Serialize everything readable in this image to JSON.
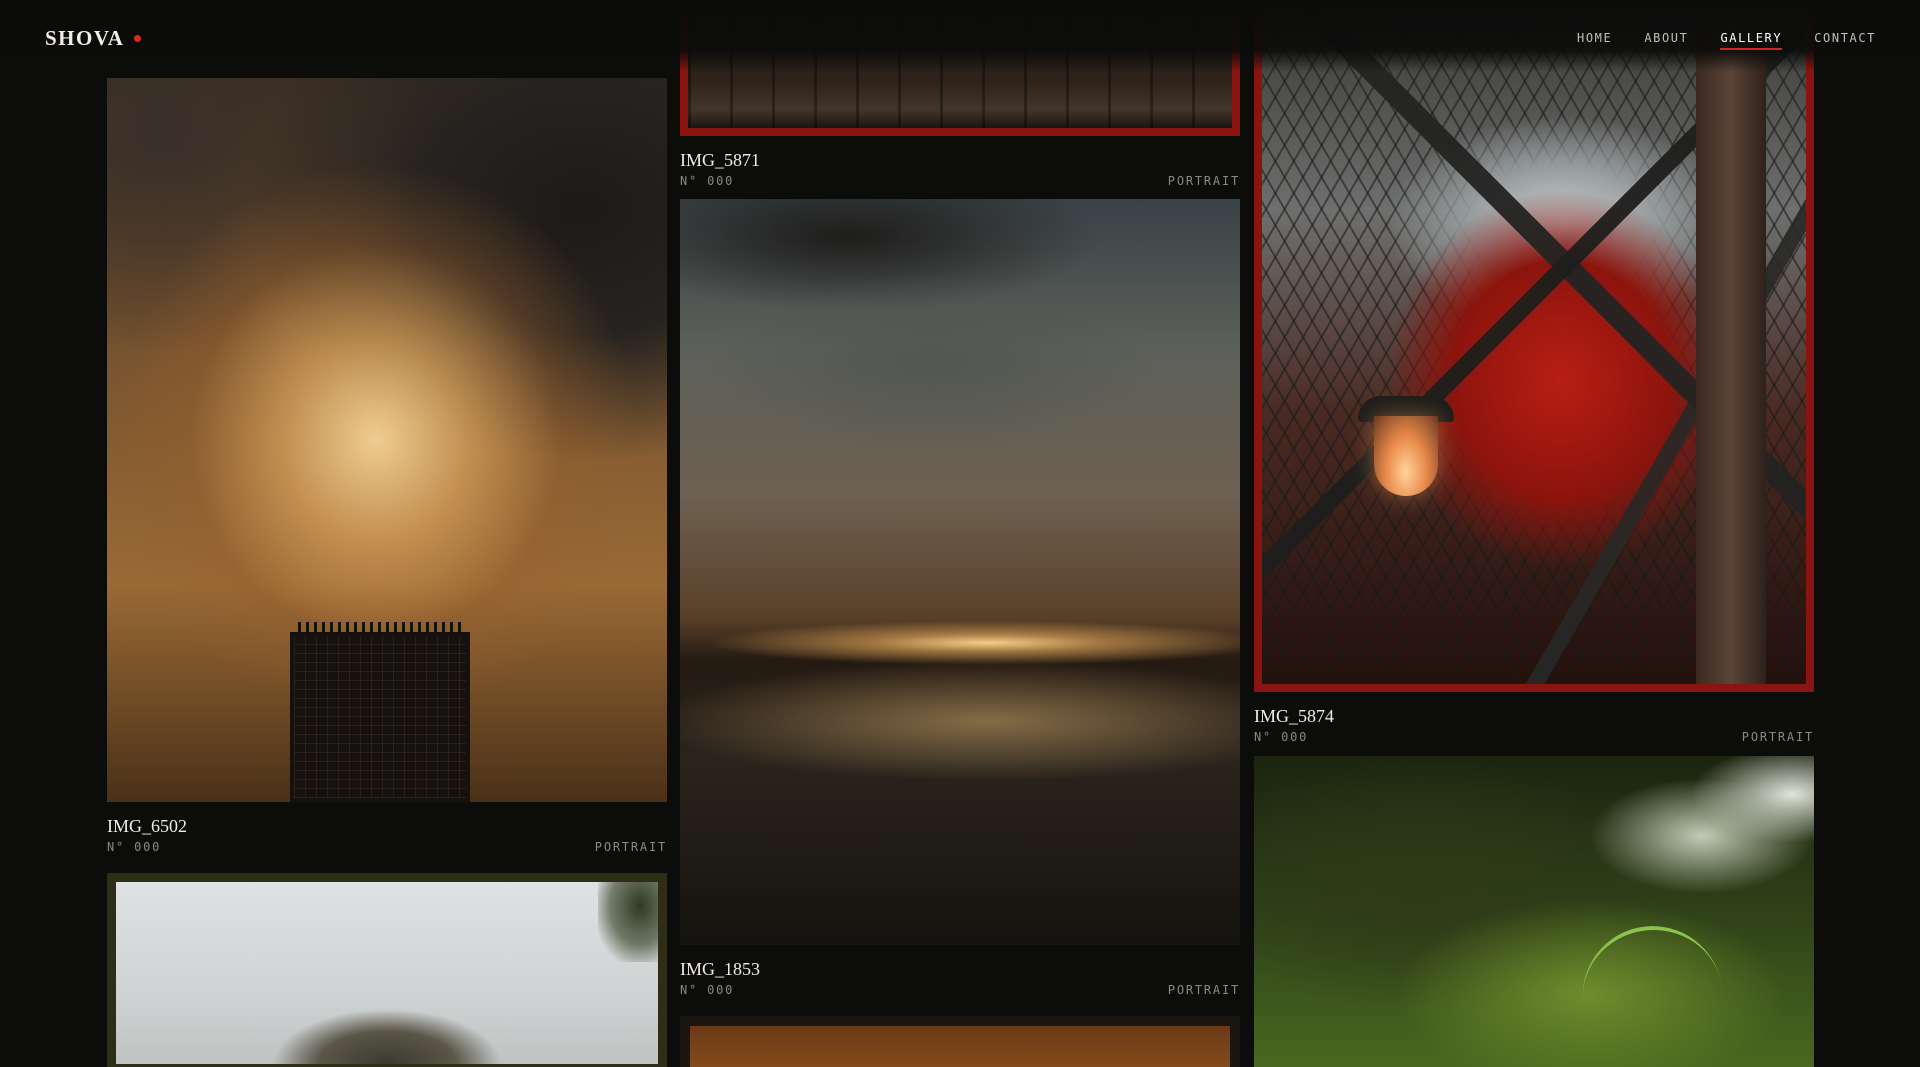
{
  "brand": {
    "name": "SHOVA"
  },
  "nav": {
    "items": [
      "HOME",
      "ABOUT",
      "GALLERY",
      "CONTACT"
    ],
    "active": "GALLERY"
  },
  "colors": {
    "accent": "#d4261b",
    "background": "#0c0c0b",
    "frame_red": "#8a1510"
  },
  "gallery": {
    "cards": [
      {
        "title": "IMG_6502",
        "number": "N° 000",
        "tag": "PORTRAIT"
      },
      {
        "title": "IMG_5871",
        "number": "N° 000",
        "tag": "PORTRAIT"
      },
      {
        "title": "IMG_1853",
        "number": "N° 000",
        "tag": "PORTRAIT"
      },
      {
        "title": "IMG_5874",
        "number": "N° 000",
        "tag": "PORTRAIT"
      }
    ]
  }
}
